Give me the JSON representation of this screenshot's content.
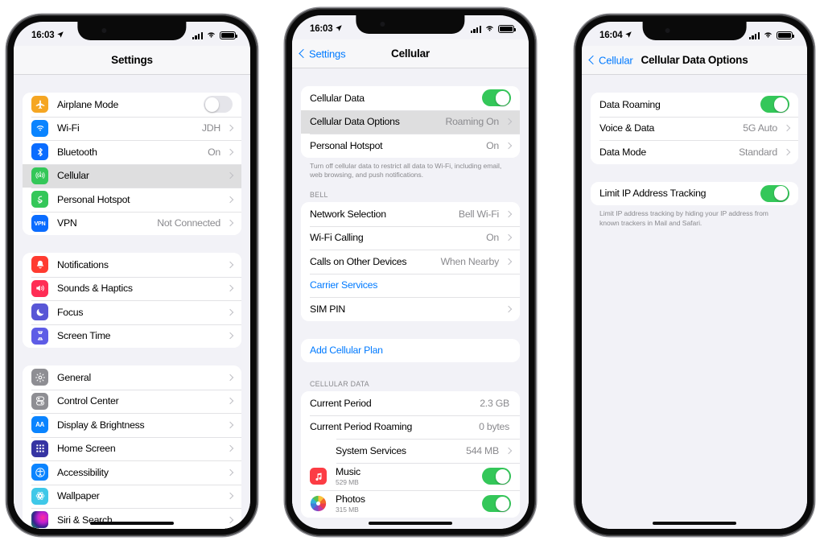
{
  "phones": [
    {
      "id": "settings",
      "status": {
        "time": "16:03",
        "location_icon": "location-arrow-icon",
        "signal_icon": "signal-bars-icon",
        "wifi_icon": "wifi-icon",
        "battery_icon": "battery-icon"
      },
      "nav": {
        "title": "Settings",
        "back": null
      },
      "groups": [
        {
          "rows": [
            {
              "icon": "airplane-icon",
              "icon_color": "#f5a623",
              "label": "Airplane Mode",
              "control": "toggle",
              "toggle_on": false
            },
            {
              "icon": "wifi-icon",
              "icon_color": "#0a84ff",
              "label": "Wi-Fi",
              "value": "JDH",
              "control": "chevron"
            },
            {
              "icon": "bluetooth-icon",
              "icon_color": "#0a6cff",
              "label": "Bluetooth",
              "value": "On",
              "control": "chevron"
            },
            {
              "icon": "cellular-icon",
              "icon_color": "#34c759",
              "label": "Cellular",
              "value": "",
              "control": "chevron",
              "selected": true
            },
            {
              "icon": "hotspot-icon",
              "icon_color": "#34c759",
              "label": "Personal Hotspot",
              "value": "",
              "control": "chevron"
            },
            {
              "icon": "vpn-icon",
              "icon_color": "#0a6cff",
              "label": "VPN",
              "value": "Not Connected",
              "control": "chevron"
            }
          ]
        },
        {
          "rows": [
            {
              "icon": "notifications-icon",
              "icon_color": "#ff3b30",
              "label": "Notifications",
              "value": "",
              "control": "chevron"
            },
            {
              "icon": "sounds-icon",
              "icon_color": "#ff2d55",
              "label": "Sounds & Haptics",
              "value": "",
              "control": "chevron"
            },
            {
              "icon": "focus-icon",
              "icon_color": "#5856d6",
              "label": "Focus",
              "value": "",
              "control": "chevron"
            },
            {
              "icon": "screentime-icon",
              "icon_color": "#5e5ce6",
              "label": "Screen Time",
              "value": "",
              "control": "chevron"
            }
          ]
        },
        {
          "rows": [
            {
              "icon": "gear-icon",
              "icon_color": "#8e8e93",
              "label": "General",
              "value": "",
              "control": "chevron"
            },
            {
              "icon": "control-center-icon",
              "icon_color": "#8e8e93",
              "label": "Control Center",
              "value": "",
              "control": "chevron"
            },
            {
              "icon": "display-brightness-icon",
              "icon_color": "#0a84ff",
              "label": "Display & Brightness",
              "value": "",
              "control": "chevron"
            },
            {
              "icon": "home-screen-icon",
              "icon_color": "#3634a3",
              "label": "Home Screen",
              "value": "",
              "control": "chevron"
            },
            {
              "icon": "accessibility-icon",
              "icon_color": "#0a84ff",
              "label": "Accessibility",
              "value": "",
              "control": "chevron"
            },
            {
              "icon": "wallpaper-icon",
              "icon_color": "#3fc8e8",
              "label": "Wallpaper",
              "value": "",
              "control": "chevron"
            },
            {
              "icon": "siri-search-icon",
              "icon_color": "#2b2b30",
              "label": "Siri & Search",
              "value": "",
              "control": "chevron"
            }
          ]
        }
      ]
    },
    {
      "id": "cellular",
      "status": {
        "time": "16:03"
      },
      "nav": {
        "title": "Cellular",
        "back": "Settings"
      },
      "groups": [
        {
          "rows": [
            {
              "label": "Cellular Data",
              "control": "toggle",
              "toggle_on": true
            },
            {
              "label": "Cellular Data Options",
              "value": "Roaming On",
              "control": "chevron",
              "selected": true
            },
            {
              "label": "Personal Hotspot",
              "value": "On",
              "control": "chevron"
            }
          ],
          "footnote": "Turn off cellular data to restrict all data to Wi-Fi, including email, web browsing, and push notifications."
        },
        {
          "header": "BELL",
          "rows": [
            {
              "label": "Network Selection",
              "value": "Bell Wi-Fi",
              "control": "chevron"
            },
            {
              "label": "Wi-Fi Calling",
              "value": "On",
              "control": "chevron"
            },
            {
              "label": "Calls on Other Devices",
              "value": "When Nearby",
              "control": "chevron"
            },
            {
              "label": "Carrier Services",
              "link": true,
              "control": "none"
            },
            {
              "label": "SIM PIN",
              "value": "",
              "control": "chevron"
            }
          ]
        },
        {
          "rows": [
            {
              "label": "Add Cellular Plan",
              "link": true,
              "control": "none"
            }
          ]
        },
        {
          "header": "CELLULAR DATA",
          "rows": [
            {
              "label": "Current Period",
              "value": "2.3 GB",
              "control": "none"
            },
            {
              "label": "Current Period Roaming",
              "value": "0 bytes",
              "control": "none"
            },
            {
              "label": "System Services",
              "value": "544 MB",
              "control": "chevron",
              "indent": true
            },
            {
              "icon": "music-icon",
              "icon_color": "#fc3c44",
              "label": "Music",
              "sublabel": "529 MB",
              "control": "toggle",
              "toggle_on": true
            },
            {
              "icon": "photos-icon",
              "icon_color": "#ffffff",
              "label": "Photos",
              "sublabel": "315 MB",
              "control": "toggle",
              "toggle_on": true
            }
          ]
        }
      ]
    },
    {
      "id": "cellular-data-options",
      "status": {
        "time": "16:04"
      },
      "nav": {
        "title": "Cellular Data Options",
        "back": "Cellular"
      },
      "groups": [
        {
          "rows": [
            {
              "label": "Data Roaming",
              "control": "toggle",
              "toggle_on": true
            },
            {
              "label": "Voice & Data",
              "value": "5G Auto",
              "control": "chevron"
            },
            {
              "label": "Data Mode",
              "value": "Standard",
              "control": "chevron"
            }
          ]
        },
        {
          "rows": [
            {
              "label": "Limit IP Address Tracking",
              "control": "toggle",
              "toggle_on": true
            }
          ],
          "footnote": "Limit IP address tracking by hiding your IP address from known trackers in Mail and Safari."
        }
      ]
    }
  ],
  "colors": {
    "accent_blue": "#007aff",
    "toggle_green": "#34c759",
    "background": "#f2f2f7",
    "card": "#ffffff",
    "secondary_text": "#8a8a8e",
    "selected_row": "#dededf"
  }
}
